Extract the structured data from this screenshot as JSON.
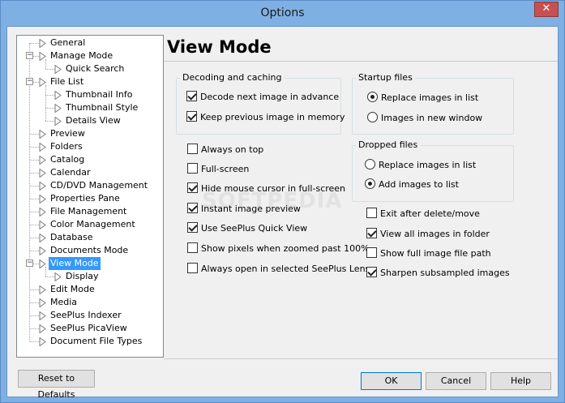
{
  "window": {
    "title": "Options",
    "close_glyph": "✕"
  },
  "tree": {
    "items": [
      {
        "label": "General",
        "level": 0
      },
      {
        "label": "Manage Mode",
        "level": 0,
        "expander": "−"
      },
      {
        "label": "Quick Search",
        "level": 1
      },
      {
        "label": "File List",
        "level": 0,
        "expander": "−"
      },
      {
        "label": "Thumbnail Info",
        "level": 1
      },
      {
        "label": "Thumbnail Style",
        "level": 1
      },
      {
        "label": "Details View",
        "level": 1
      },
      {
        "label": "Preview",
        "level": 0
      },
      {
        "label": "Folders",
        "level": 0
      },
      {
        "label": "Catalog",
        "level": 0
      },
      {
        "label": "Calendar",
        "level": 0
      },
      {
        "label": "CD/DVD Management",
        "level": 0
      },
      {
        "label": "Properties Pane",
        "level": 0
      },
      {
        "label": "File Management",
        "level": 0
      },
      {
        "label": "Color Management",
        "level": 0
      },
      {
        "label": "Database",
        "level": 0
      },
      {
        "label": "Documents Mode",
        "level": 0
      },
      {
        "label": "View Mode",
        "level": 0,
        "expander": "−",
        "selected": true
      },
      {
        "label": "Display",
        "level": 1
      },
      {
        "label": "Edit Mode",
        "level": 0
      },
      {
        "label": "Media",
        "level": 0
      },
      {
        "label": "SeePlus Indexer",
        "level": 0
      },
      {
        "label": "SeePlus PicaView",
        "level": 0
      },
      {
        "label": "Document File Types",
        "level": 0
      }
    ]
  },
  "main": {
    "title": "View Mode",
    "decoding": {
      "title": "Decoding and caching",
      "options": [
        {
          "label": "Decode next image in advance",
          "checked": true
        },
        {
          "label": "Keep previous image in memory",
          "checked": true
        }
      ]
    },
    "startup": {
      "title": "Startup files",
      "options": [
        {
          "label": "Replace images in list",
          "checked": true
        },
        {
          "label": "Images in new window",
          "checked": false
        }
      ]
    },
    "dropped": {
      "title": "Dropped files",
      "options": [
        {
          "label": "Replace images in list",
          "checked": false
        },
        {
          "label": "Add images to list",
          "checked": true
        }
      ]
    },
    "left_options": [
      {
        "label": "Always on top",
        "checked": false
      },
      {
        "label": "Full-screen",
        "checked": false
      },
      {
        "label": "Hide mouse cursor in full-screen",
        "checked": true
      },
      {
        "label": "Instant image preview",
        "checked": true
      },
      {
        "label": "Use SeePlus Quick View",
        "checked": true
      },
      {
        "label": "Show pixels when zoomed past 100%",
        "checked": false
      },
      {
        "label": "Always open in selected SeePlus Lens",
        "checked": false
      }
    ],
    "right_options": [
      {
        "label": "Exit after delete/move",
        "checked": false
      },
      {
        "label": "View all images in folder",
        "checked": true
      },
      {
        "label": "Show full image file path",
        "checked": false
      },
      {
        "label": "Sharpen subsampled images",
        "checked": true
      }
    ],
    "watermark": "SOFTPEDIA"
  },
  "buttons": {
    "reset": "Reset to Defaults",
    "ok": "OK",
    "cancel": "Cancel",
    "help": "Help"
  }
}
